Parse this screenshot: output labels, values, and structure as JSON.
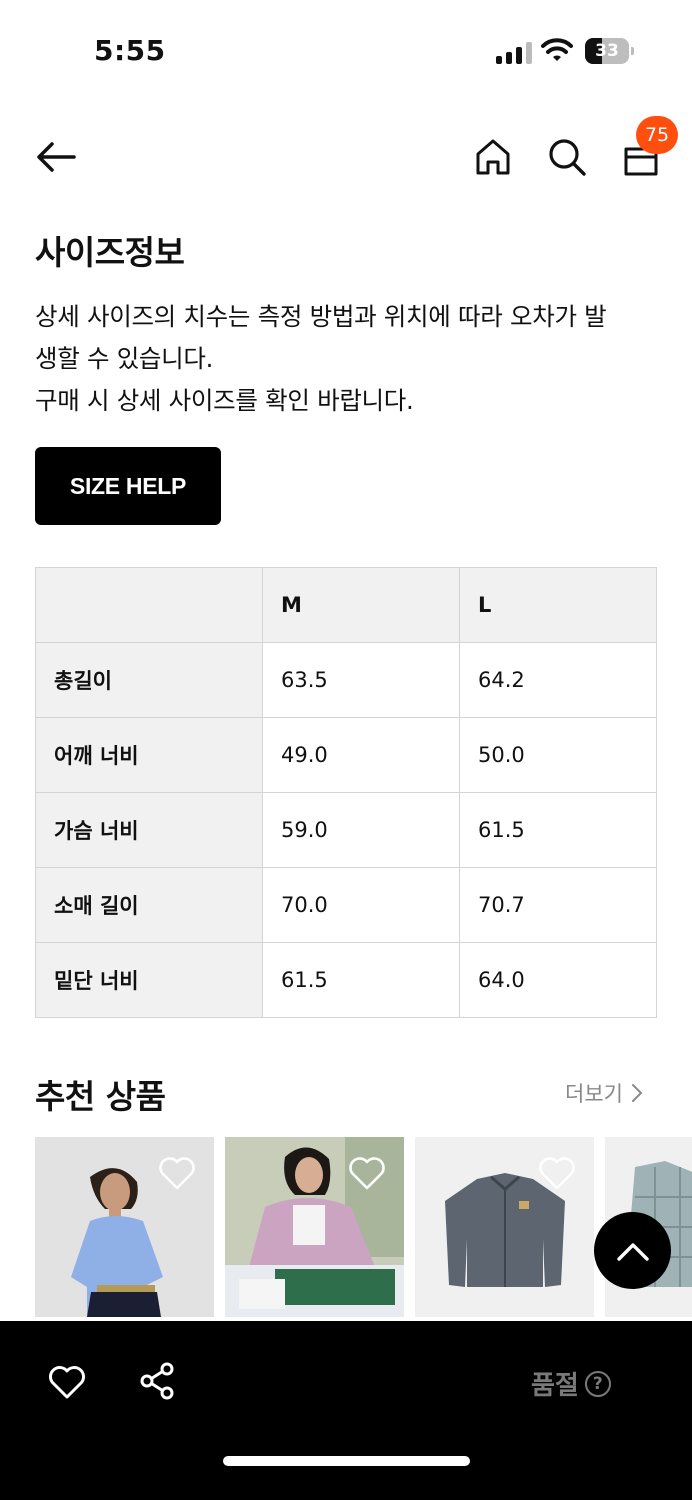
{
  "status_bar": {
    "time": "5:55",
    "battery": "33"
  },
  "nav": {
    "cart_count": "75"
  },
  "size_info": {
    "title": "사이즈정보",
    "description_lines": [
      "상세 사이즈의 치수는 측정 방법과 위치에 따라 오차가 발",
      "생할 수 있습니다.",
      "구매 시 상세 사이즈를 확인 바랍니다."
    ],
    "size_help_label": "SIZE HELP",
    "table": {
      "headers": [
        "",
        "M",
        "L"
      ],
      "rows": [
        {
          "label": "총길이",
          "values": [
            "63.5",
            "64.2"
          ]
        },
        {
          "label": "어깨 너비",
          "values": [
            "49.0",
            "50.0"
          ]
        },
        {
          "label": "가슴 너비",
          "values": [
            "59.0",
            "61.5"
          ]
        },
        {
          "label": "소매 길이",
          "values": [
            "70.0",
            "70.7"
          ]
        },
        {
          "label": "밑단 너비",
          "values": [
            "61.5",
            "64.0"
          ]
        }
      ]
    }
  },
  "recommend": {
    "title": "추천 상품",
    "more_label": "더보기"
  },
  "bottom_bar": {
    "soldout_label": "품절",
    "help_glyph": "?"
  },
  "colors": {
    "accent_badge": "#ff4f0f",
    "table_header_bg": "#f1f1f1"
  }
}
